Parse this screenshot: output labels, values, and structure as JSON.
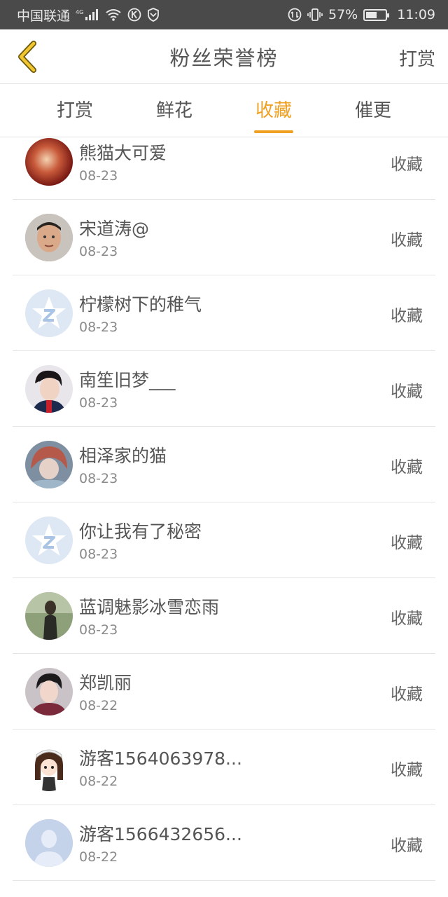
{
  "status_bar": {
    "carrier": "中国联通",
    "network": "4G",
    "battery": "57%",
    "battery_level": 0.57,
    "time": "11:09"
  },
  "header": {
    "title": "粉丝荣誉榜",
    "action_label": "打赏",
    "back_icon": "chevron-left-icon",
    "accent_color": "#f0a020"
  },
  "tabs": [
    {
      "label": "打赏",
      "active": false
    },
    {
      "label": "鲜花",
      "active": false
    },
    {
      "label": "收藏",
      "active": true
    },
    {
      "label": "催更",
      "active": false
    }
  ],
  "list": [
    {
      "name": "熊猫大可爱",
      "date": "08-23",
      "action": "收藏",
      "avatar": "photo-red"
    },
    {
      "name": "宋道涛@",
      "date": "08-23",
      "action": "收藏",
      "avatar": "photo-face"
    },
    {
      "name": "柠檬树下的稚气",
      "date": "08-23",
      "action": "收藏",
      "avatar": "qq-default"
    },
    {
      "name": "南笙旧梦___",
      "date": "08-23",
      "action": "收藏",
      "avatar": "photo-person"
    },
    {
      "name": "相泽家的猫",
      "date": "08-23",
      "action": "收藏",
      "avatar": "photo-anime"
    },
    {
      "name": "你让我有了秘密",
      "date": "08-23",
      "action": "收藏",
      "avatar": "qq-default"
    },
    {
      "name": "蓝调魅影冰雪恋雨",
      "date": "08-23",
      "action": "收藏",
      "avatar": "photo-green"
    },
    {
      "name": "郑凯丽",
      "date": "08-22",
      "action": "收藏",
      "avatar": "photo-person"
    },
    {
      "name": "游客1564063978...",
      "date": "08-22",
      "action": "收藏",
      "avatar": "cartoon-girl"
    },
    {
      "name": "游客1566432656...",
      "date": "08-22",
      "action": "收藏",
      "avatar": "default-user"
    }
  ]
}
